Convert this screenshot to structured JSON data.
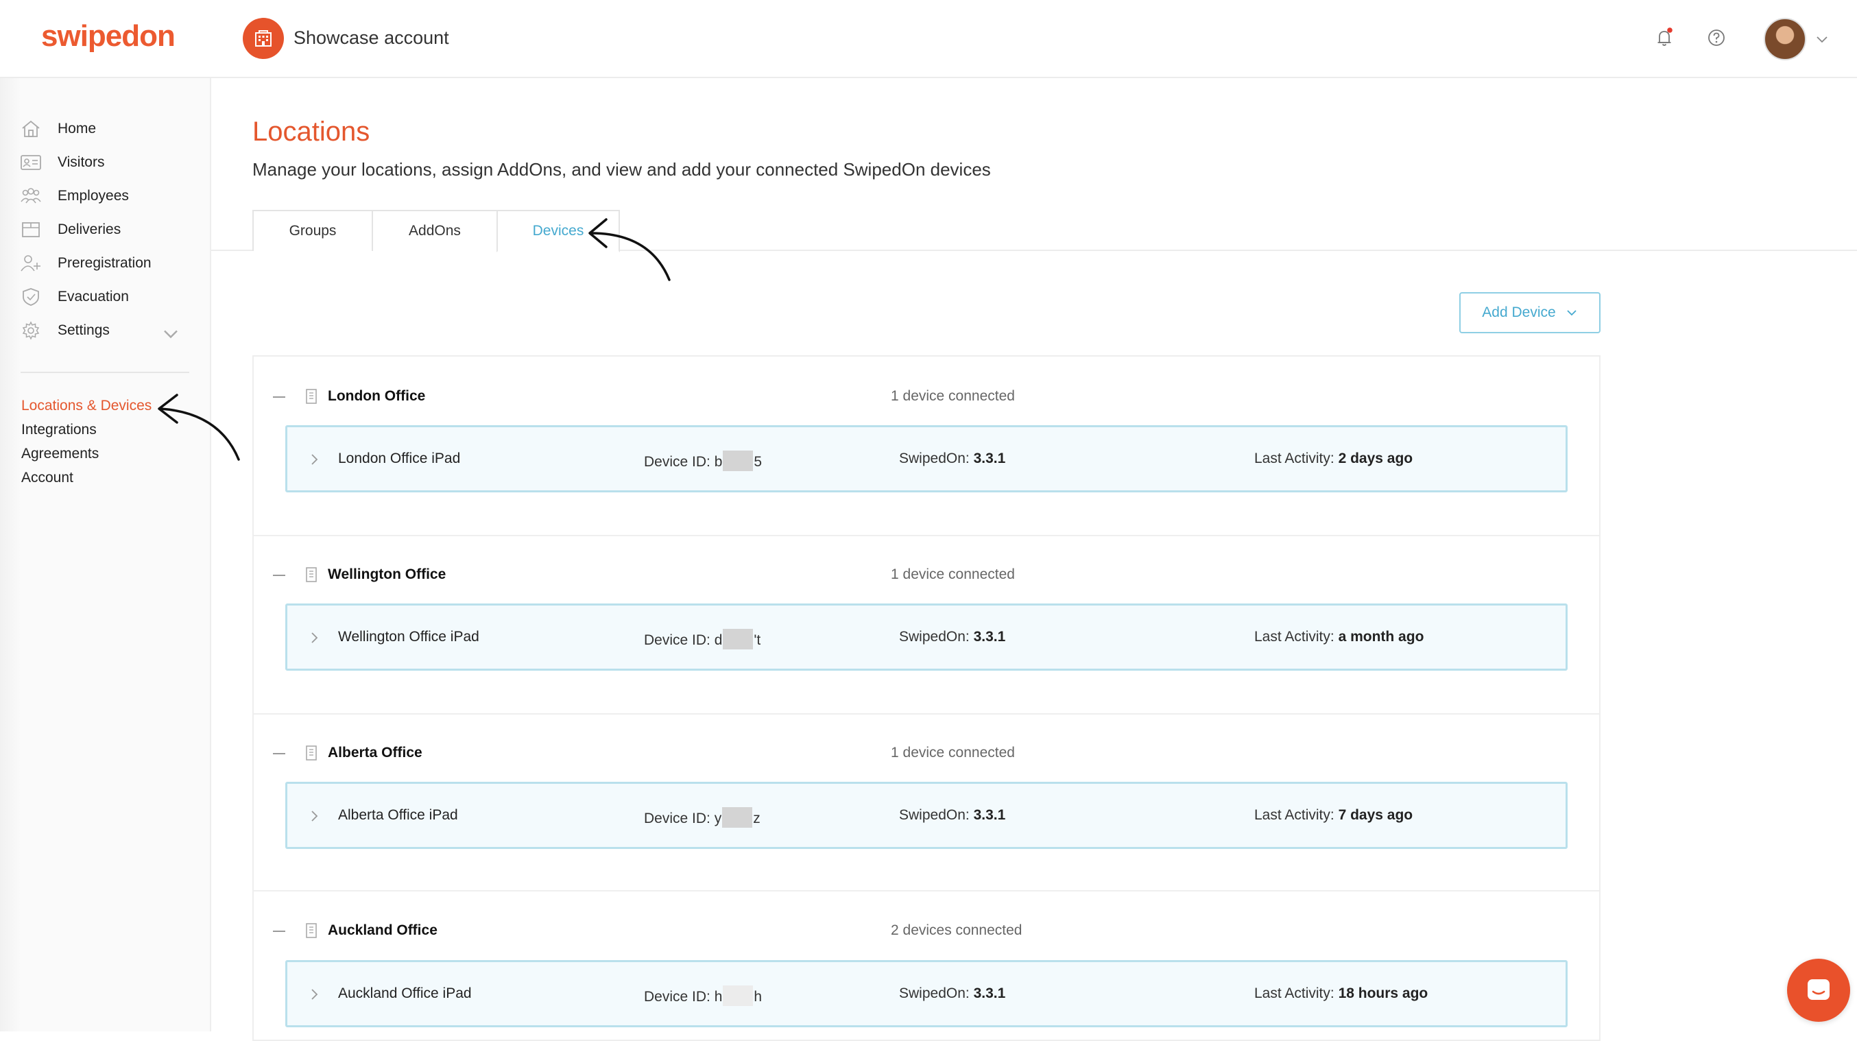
{
  "header": {
    "logo": "swipedon",
    "account_name": "Showcase account"
  },
  "sidebar": {
    "items": [
      {
        "label": "Home"
      },
      {
        "label": "Visitors"
      },
      {
        "label": "Employees"
      },
      {
        "label": "Deliveries"
      },
      {
        "label": "Preregistration"
      },
      {
        "label": "Evacuation"
      },
      {
        "label": "Settings"
      }
    ],
    "subitems": [
      {
        "label": "Locations & Devices"
      },
      {
        "label": "Integrations"
      },
      {
        "label": "Agreements"
      },
      {
        "label": "Account"
      }
    ]
  },
  "main": {
    "title": "Locations",
    "subtitle": "Manage your locations, assign AddOns, and view and add your connected SwipedOn devices",
    "tabs": [
      {
        "label": "Groups"
      },
      {
        "label": "AddOns"
      },
      {
        "label": "Devices"
      }
    ],
    "add_device_label": "Add Device",
    "groups": [
      {
        "name": "London Office",
        "count": "1 device connected",
        "device": {
          "name": "London Office iPad",
          "id_label": "Device ID:",
          "id_start": "b",
          "id_end": "5",
          "ver_label": "SwipedOn:",
          "ver": "3.3.1",
          "act_label": "Last Activity:",
          "act": "2 days ago"
        }
      },
      {
        "name": "Wellington Office",
        "count": "1 device connected",
        "device": {
          "name": "Wellington Office iPad",
          "id_label": "Device ID:",
          "id_start": "d",
          "id_end": "'t",
          "ver_label": "SwipedOn:",
          "ver": "3.3.1",
          "act_label": "Last Activity:",
          "act": "a month ago"
        }
      },
      {
        "name": "Alberta Office",
        "count": "1 device connected",
        "device": {
          "name": "Alberta Office iPad",
          "id_label": "Device ID:",
          "id_start": "y",
          "id_end": "z",
          "ver_label": "SwipedOn:",
          "ver": "3.3.1",
          "act_label": "Last Activity:",
          "act": "7 days ago"
        }
      },
      {
        "name": "Auckland Office",
        "count": "2 devices connected",
        "device": {
          "name": "Auckland Office iPad",
          "id_label": "Device ID:",
          "id_start": "h",
          "id_end": "h",
          "ver_label": "SwipedOn:",
          "ver": "3.3.1",
          "act_label": "Last Activity:",
          "act": "18 hours ago"
        }
      }
    ]
  },
  "colors": {
    "brand": "#e4572e",
    "accent": "#45a9cf",
    "row_border": "#b9e0ec"
  },
  "icons": {
    "notifications": "bell-icon",
    "help": "help-icon",
    "chat": "chat-icon"
  }
}
